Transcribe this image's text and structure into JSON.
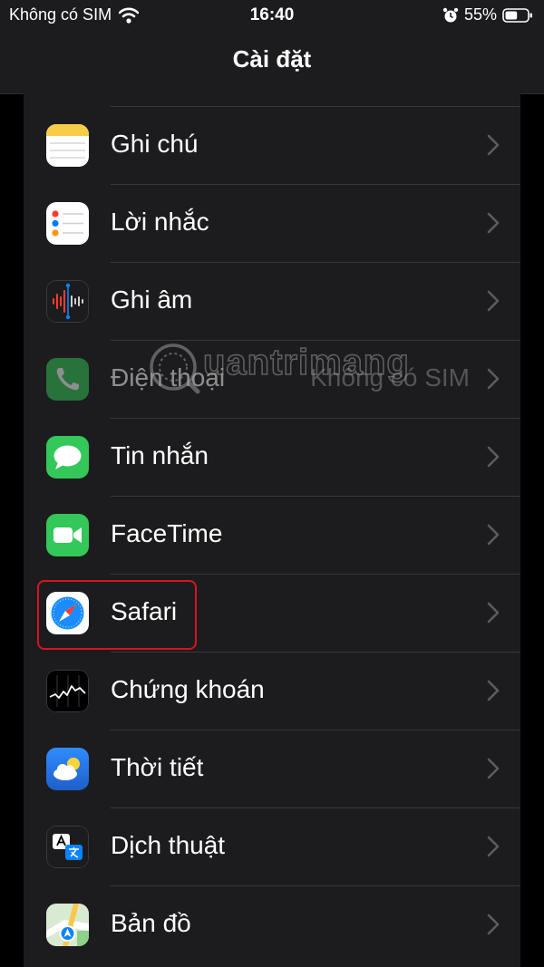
{
  "status_bar": {
    "carrier": "Không có SIM",
    "time": "16:40",
    "battery": "55%",
    "battery_level": 0.55,
    "icons": [
      "wifi-icon",
      "alarm-icon",
      "battery-icon"
    ]
  },
  "nav": {
    "title": "Cài đặt"
  },
  "rows": [
    {
      "label": "Ghi chú",
      "icon": "notes-icon"
    },
    {
      "label": "Lời nhắc",
      "icon": "reminders-icon"
    },
    {
      "label": "Ghi âm",
      "icon": "voice-memos-icon"
    },
    {
      "label": "Điện thoại",
      "detail": "Không có SIM",
      "icon": "phone-icon",
      "disabled": true
    },
    {
      "label": "Tin nhắn",
      "icon": "messages-icon"
    },
    {
      "label": "FaceTime",
      "icon": "facetime-icon"
    },
    {
      "label": "Safari",
      "icon": "safari-icon",
      "highlighted": true
    },
    {
      "label": "Chứng khoán",
      "icon": "stocks-icon"
    },
    {
      "label": "Thời tiết",
      "icon": "weather-icon"
    },
    {
      "label": "Dịch thuật",
      "icon": "translate-icon"
    },
    {
      "label": "Bản đồ",
      "icon": "maps-icon"
    }
  ],
  "watermark": {
    "text": "uantrimang"
  },
  "colors": {
    "highlight": "#d9131f",
    "background": "#000000",
    "cell": "#1c1c1e"
  }
}
